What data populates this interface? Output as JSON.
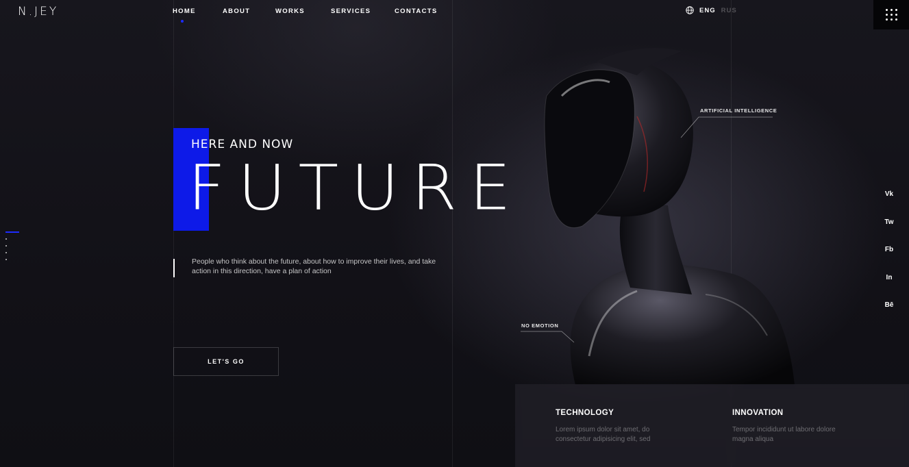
{
  "header": {
    "logo": "N.JEY",
    "nav": [
      {
        "label": "HOME",
        "active": true
      },
      {
        "label": "ABOUT"
      },
      {
        "label": "WORKS"
      },
      {
        "label": "SERVICES"
      },
      {
        "label": "CONTACTS"
      }
    ],
    "languages": {
      "current": "ENG",
      "other": "RUS"
    },
    "menu_icon": "grid-menu-icon"
  },
  "hero": {
    "tagline": "HERE AND NOW",
    "title": "FUTURE",
    "description": "People who think about the future, about how to improve their lives, and take action in this direction, have a plan of action",
    "cta_label": "LET'S GO"
  },
  "callouts": {
    "top": "ARTIFICIAL INTELLIGENCE",
    "bottom": "NO EMOTION"
  },
  "socials": [
    "Vk",
    "Tw",
    "Fb",
    "In",
    "Bē"
  ],
  "features": [
    {
      "title": "TECHNOLOGY",
      "text": "Lorem ipsum dolor sit amet, do consectetur adipisicing elit, sed"
    },
    {
      "title": "INNOVATION",
      "text": "Tempor incididunt ut labore dolore magna aliqua"
    }
  ],
  "colors": {
    "accent": "#0d1ae8",
    "background": "#121118",
    "text": "#ffffff"
  }
}
